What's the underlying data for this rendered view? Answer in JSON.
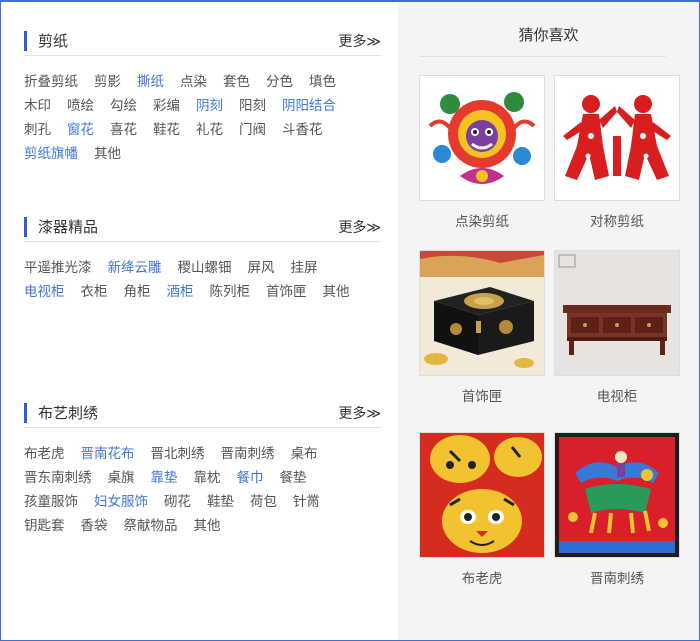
{
  "sections": [
    {
      "title": "剪纸",
      "more": "更多≫",
      "tags": [
        {
          "label": "折叠剪纸",
          "highlight": false
        },
        {
          "label": "剪影",
          "highlight": false
        },
        {
          "label": "撕纸",
          "highlight": true
        },
        {
          "label": "点染",
          "highlight": false
        },
        {
          "label": "套色",
          "highlight": false
        },
        {
          "label": "分色",
          "highlight": false
        },
        {
          "label": "填色",
          "highlight": false
        },
        {
          "label": "木印",
          "highlight": false
        },
        {
          "label": "喷绘",
          "highlight": false
        },
        {
          "label": "勾绘",
          "highlight": false
        },
        {
          "label": "彩编",
          "highlight": false
        },
        {
          "label": "阴刻",
          "highlight": true
        },
        {
          "label": "阳刻",
          "highlight": false
        },
        {
          "label": "阴阳结合",
          "highlight": true
        },
        {
          "label": "刺孔",
          "highlight": false
        },
        {
          "label": "窗花",
          "highlight": true
        },
        {
          "label": "喜花",
          "highlight": false
        },
        {
          "label": "鞋花",
          "highlight": false
        },
        {
          "label": "礼花",
          "highlight": false
        },
        {
          "label": "门阀",
          "highlight": false
        },
        {
          "label": "斗香花",
          "highlight": false
        },
        {
          "label": "剪纸旗幡",
          "highlight": true
        },
        {
          "label": "其他",
          "highlight": false
        }
      ]
    },
    {
      "title": "漆器精品",
      "more": "更多≫",
      "tags": [
        {
          "label": "平遥推光漆",
          "highlight": false
        },
        {
          "label": "新绛云雕",
          "highlight": true
        },
        {
          "label": "稷山螺钿",
          "highlight": false
        },
        {
          "label": "屏风",
          "highlight": false
        },
        {
          "label": "挂屏",
          "highlight": false
        },
        {
          "label": "电视柜",
          "highlight": true
        },
        {
          "label": "衣柜",
          "highlight": false
        },
        {
          "label": "角柜",
          "highlight": false
        },
        {
          "label": "酒柜",
          "highlight": true
        },
        {
          "label": "陈列柜",
          "highlight": false
        },
        {
          "label": "首饰匣",
          "highlight": false
        },
        {
          "label": "其他",
          "highlight": false
        }
      ]
    },
    {
      "title": "布艺刺绣",
      "more": "更多≫",
      "tags": [
        {
          "label": "布老虎",
          "highlight": false
        },
        {
          "label": "晋南花布",
          "highlight": true
        },
        {
          "label": "晋北刺绣",
          "highlight": false
        },
        {
          "label": "晋南刺绣",
          "highlight": false
        },
        {
          "label": "桌布",
          "highlight": false
        },
        {
          "label": "晋东南刺绣",
          "highlight": false
        },
        {
          "label": "桌旗",
          "highlight": false
        },
        {
          "label": "靠垫",
          "highlight": true
        },
        {
          "label": "靠枕",
          "highlight": false
        },
        {
          "label": "餐巾",
          "highlight": true
        },
        {
          "label": "餐垫",
          "highlight": false
        },
        {
          "label": "孩童服饰",
          "highlight": false
        },
        {
          "label": "妇女服饰",
          "highlight": true
        },
        {
          "label": "砌花",
          "highlight": false
        },
        {
          "label": "鞋垫",
          "highlight": false
        },
        {
          "label": "荷包",
          "highlight": false
        },
        {
          "label": "针黹",
          "highlight": false
        },
        {
          "label": "钥匙套",
          "highlight": false
        },
        {
          "label": "香袋",
          "highlight": false
        },
        {
          "label": "祭献物品",
          "highlight": false
        },
        {
          "label": "其他",
          "highlight": false
        }
      ]
    }
  ],
  "guess": {
    "title": "猜你喜欢",
    "items": [
      {
        "caption": "点染剪纸",
        "image": "colorful-papercut-lion"
      },
      {
        "caption": "对称剪纸",
        "image": "red-symmetric-papercut"
      },
      {
        "caption": "首饰匣",
        "image": "lacquer-jewelry-box"
      },
      {
        "caption": "电视柜",
        "image": "wooden-tv-cabinet"
      },
      {
        "caption": "布老虎",
        "image": "cloth-tiger"
      },
      {
        "caption": "晋南刺绣",
        "image": "embroidered-qilin"
      }
    ]
  },
  "colors": {
    "accent": "#2d5fcf",
    "highlight_text": "#3f78d8",
    "frame": "#3f6fd1"
  }
}
